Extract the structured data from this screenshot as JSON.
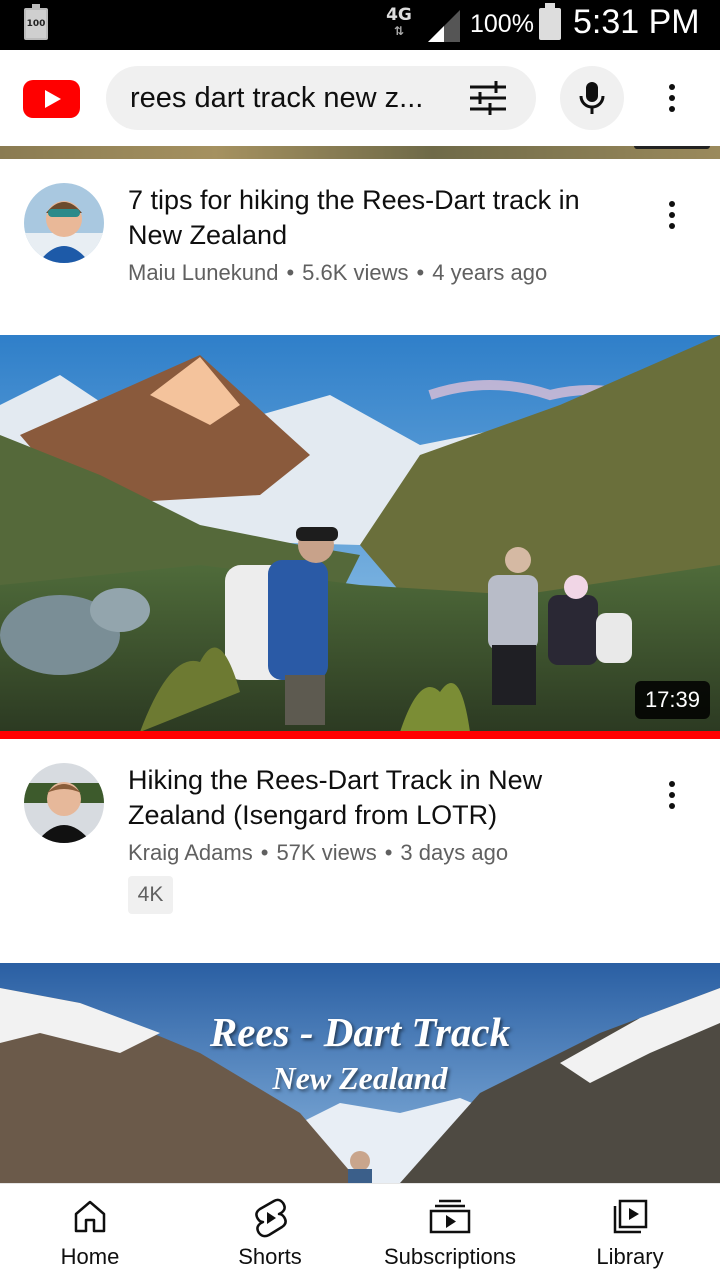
{
  "status_bar": {
    "battery_left_label": "100",
    "network": "4G",
    "battery_percent": "100%",
    "time": "5:31 PM"
  },
  "app_bar": {
    "logo": "youtube-logo",
    "search_query": "rees dart track new z...",
    "filter_icon": "sliders-icon",
    "mic_icon": "mic-icon",
    "menu_icon": "more-vert-icon"
  },
  "results": [
    {
      "title": "7 tips for hiking the Rees-Dart track in New Zealand",
      "channel": "Maiu Lunekund",
      "views": "5.6K views",
      "age": "4 years ago"
    },
    {
      "title": "Hiking the Rees-Dart Track in New Zealand (Isengard from LOTR)",
      "channel": "Kraig Adams",
      "views": "57K views",
      "age": "3 days ago",
      "badge": "4K",
      "duration": "17:39",
      "watch_progress": 1.0
    },
    {
      "thumb_title": "Rees - Dart Track",
      "thumb_subtitle": "New Zealand"
    }
  ],
  "separator": "•",
  "bottom_nav": [
    {
      "label": "Home",
      "icon": "home-icon"
    },
    {
      "label": "Shorts",
      "icon": "shorts-icon"
    },
    {
      "label": "Subscriptions",
      "icon": "subscriptions-icon"
    },
    {
      "label": "Library",
      "icon": "library-icon"
    }
  ],
  "colors": {
    "brand": "#ff0000",
    "text_primary": "#0f0f0f",
    "text_secondary": "#606060",
    "chip_bg": "#f0f0f0"
  }
}
